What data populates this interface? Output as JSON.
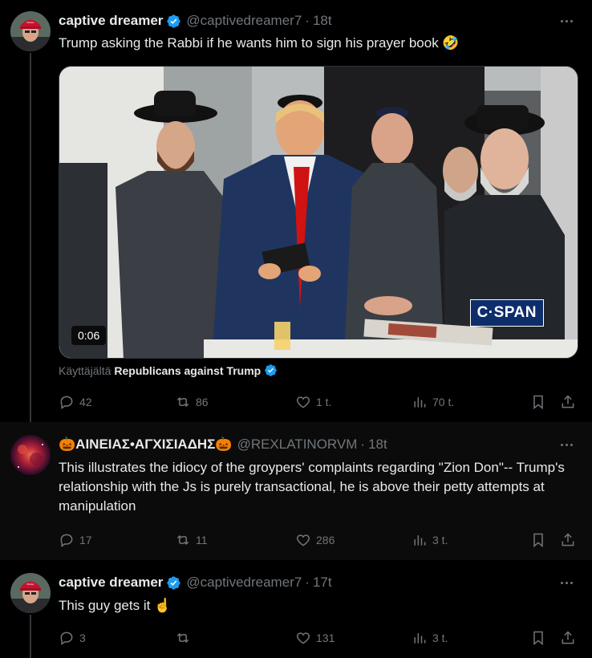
{
  "tweet1": {
    "author_name": "captive dreamer",
    "handle": "@captivedreamer7",
    "time": "18t",
    "text": "Trump asking the Rabbi if he wants him to sign his prayer book 🤣",
    "video_duration": "0:06",
    "video_watermark": "C·SPAN",
    "attribution_prefix": "Käyttäjältä",
    "attribution_name": "Republicans against Trump",
    "replies": "42",
    "reposts": "86",
    "likes": "1 t.",
    "views": "70 t."
  },
  "tweet2": {
    "author_name": "🎃ΑΙΝΕΙΑΣ•ΑΓΧΙΣΙΑΔΗΣ🎃",
    "handle": "@REXLATINORVM",
    "time": "18t",
    "text": "This illustrates the idiocy of the groypers' complaints regarding \"Zion Don\"-- Trump's relationship with the Js is purely transactional, he is above their petty attempts at manipulation",
    "replies": "17",
    "reposts": "11",
    "likes": "286",
    "views": "3 t."
  },
  "tweet3": {
    "author_name": "captive dreamer",
    "handle": "@captivedreamer7",
    "time": "17t",
    "text": "This guy gets it ☝️",
    "replies": "3",
    "reposts": "",
    "likes": "131",
    "views": "3 t."
  },
  "colors": {
    "background": "#000000",
    "text_primary": "#e7e9ea",
    "text_secondary": "#71767b",
    "verified_blue": "#1d9bf0",
    "divider": "#2f3336"
  }
}
